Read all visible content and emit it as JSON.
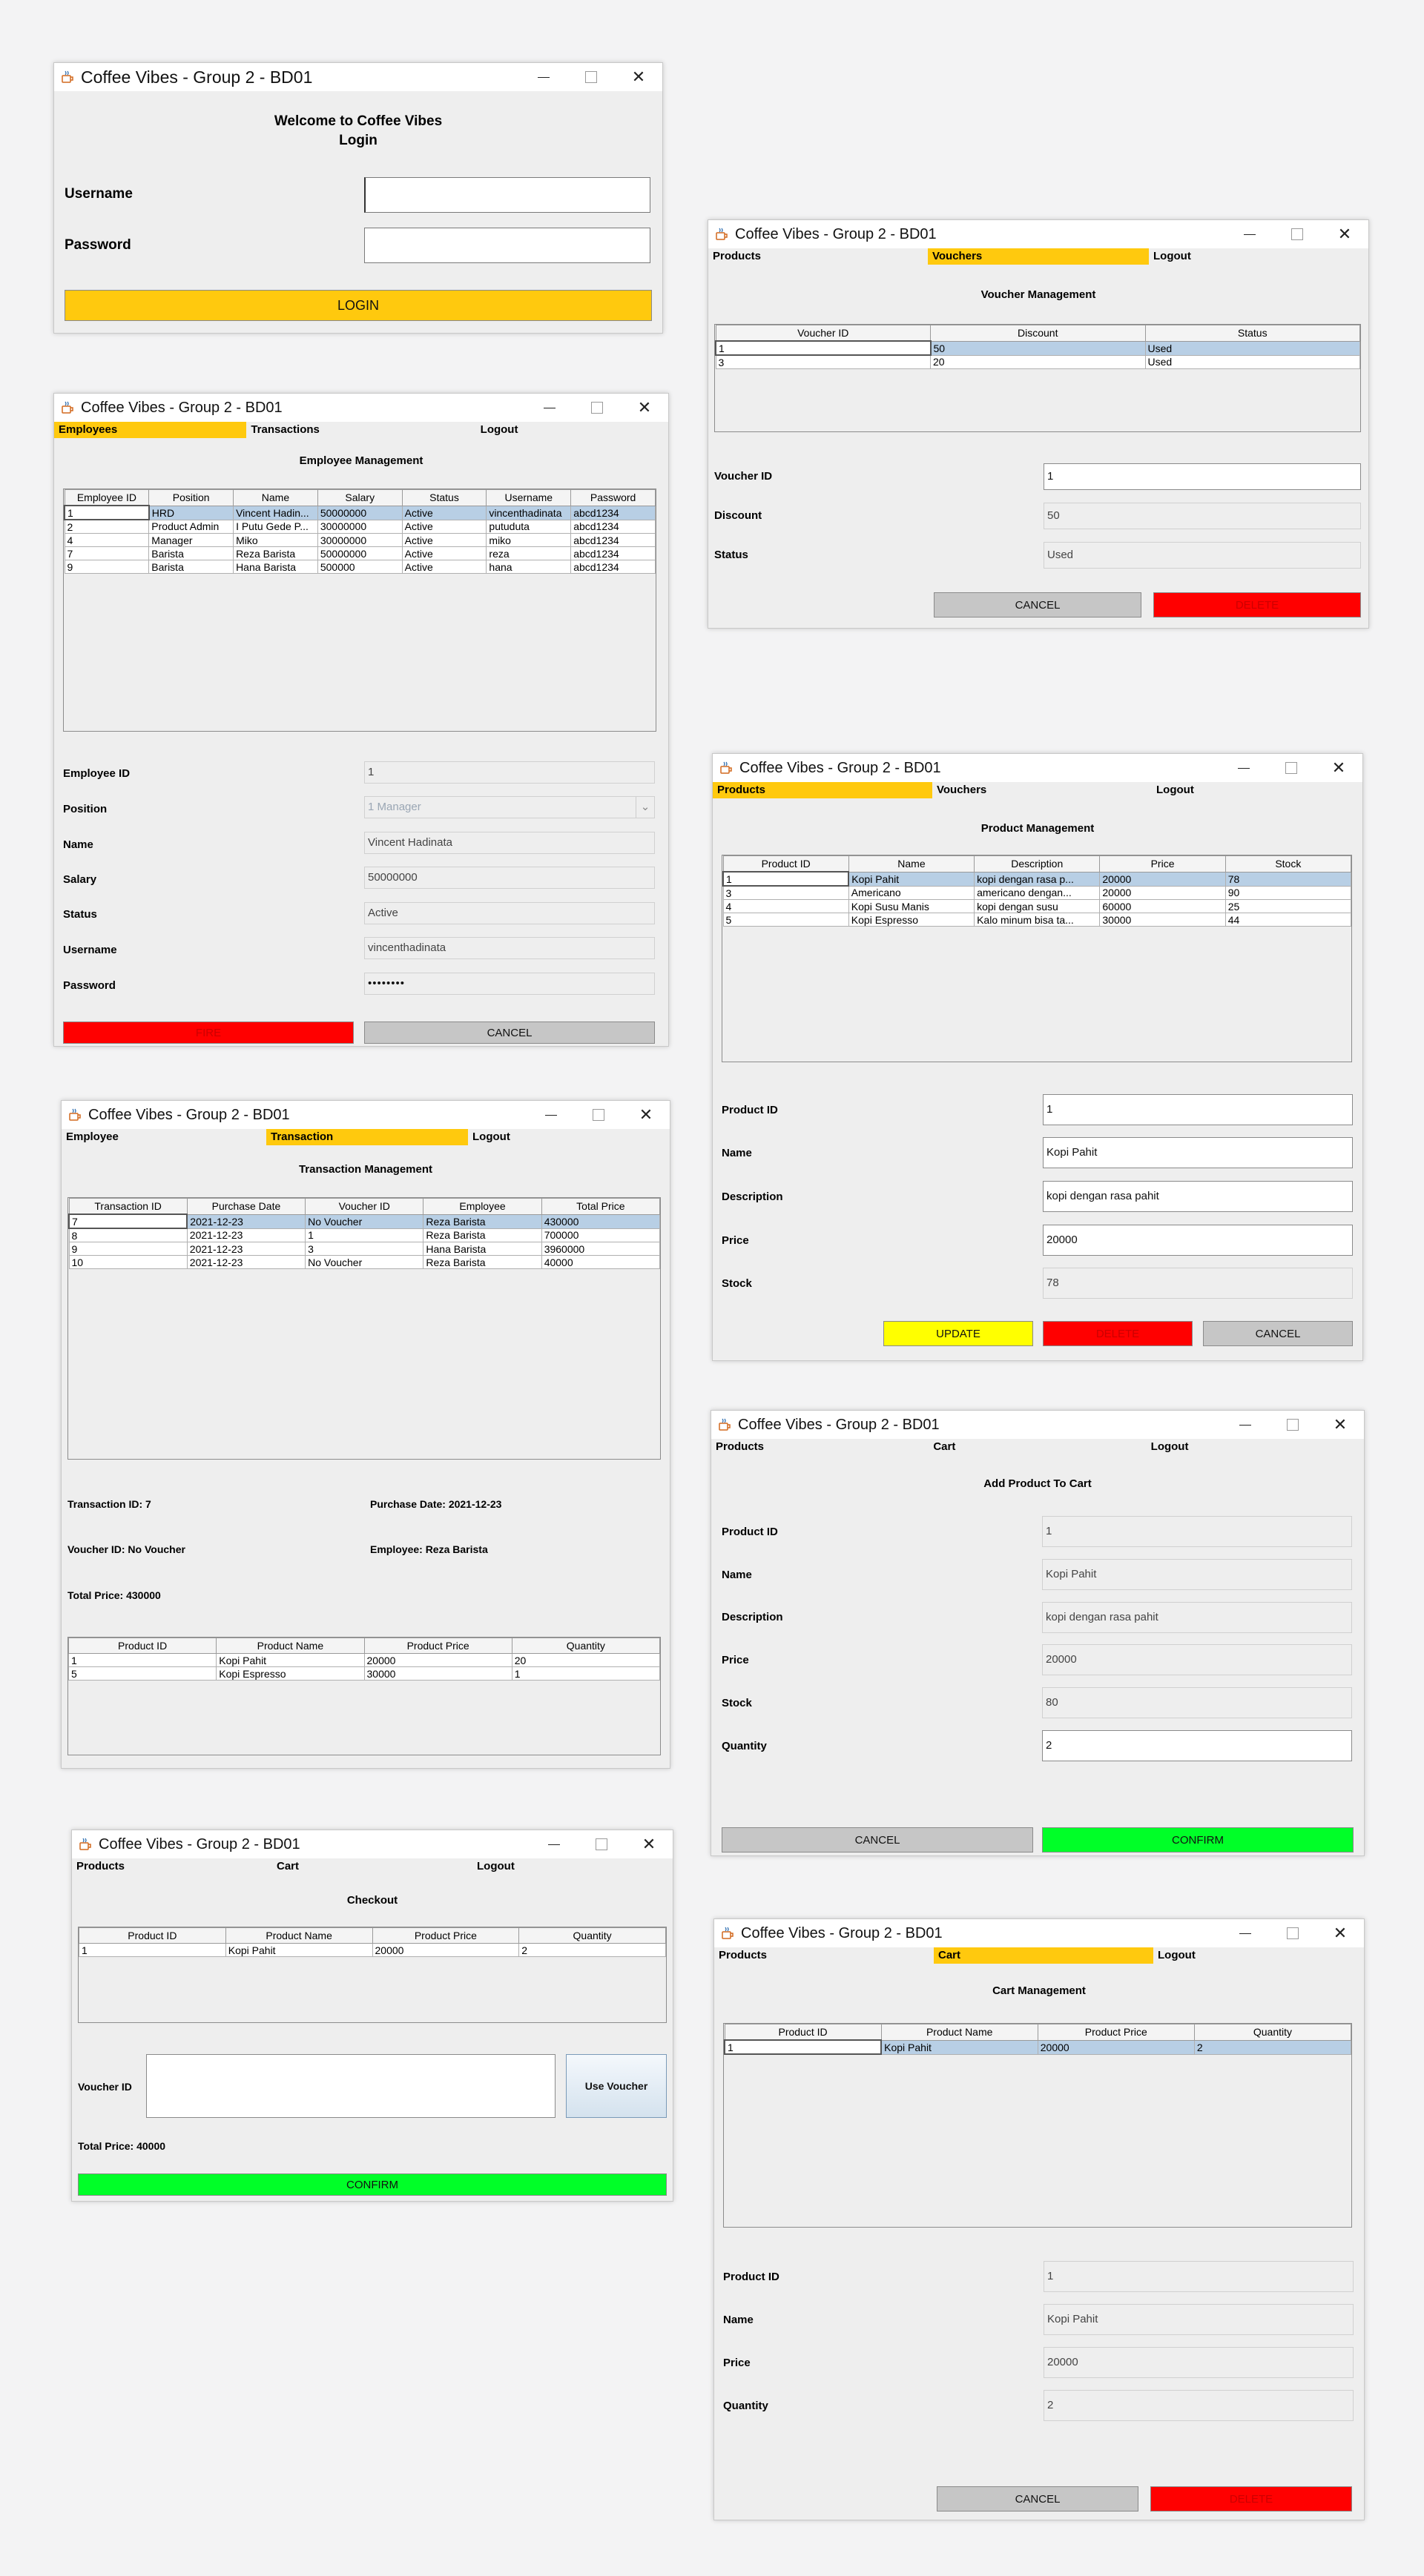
{
  "app_title": "Coffee Vibes - Group 2 - BD01",
  "title_controls": {
    "minimize": "—",
    "close": "✕"
  },
  "login": {
    "welcome": "Welcome to Coffee Vibes",
    "subtitle": "Login",
    "username_label": "Username",
    "password_label": "Password",
    "username_value": "",
    "password_value": "",
    "login_button": "LOGIN"
  },
  "employee": {
    "menu": [
      "Employees",
      "Transactions",
      "Logout"
    ],
    "active_menu": 0,
    "heading": "Employee Management",
    "columns": [
      "Employee ID",
      "Position",
      "Name",
      "Salary",
      "Status",
      "Username",
      "Password"
    ],
    "rows": [
      [
        "1",
        "HRD",
        "Vincent Hadin...",
        "50000000",
        "Active",
        "vincenthadinata",
        "abcd1234"
      ],
      [
        "2",
        "Product Admin",
        "I Putu Gede P...",
        "30000000",
        "Active",
        "putuduta",
        "abcd1234"
      ],
      [
        "4",
        "Manager",
        "Miko",
        "30000000",
        "Active",
        "miko",
        "abcd1234"
      ],
      [
        "7",
        "Barista",
        "Reza Barista",
        "50000000",
        "Active",
        "reza",
        "abcd1234"
      ],
      [
        "9",
        "Barista",
        "Hana Barista",
        "500000",
        "Active",
        "hana",
        "abcd1234"
      ]
    ],
    "selected_row": 0,
    "form": {
      "id_label": "Employee ID",
      "id_value": "1",
      "position_label": "Position",
      "position_value": "1 Manager",
      "name_label": "Name",
      "name_value": "Vincent Hadinata",
      "salary_label": "Salary",
      "salary_value": "50000000",
      "status_label": "Status",
      "status_value": "Active",
      "username_label": "Username",
      "username_value": "vincenthadinata",
      "password_label": "Password",
      "password_value": "••••••••"
    },
    "fire_button": "FIRE",
    "cancel_button": "CANCEL"
  },
  "transaction": {
    "menu": [
      "Employee",
      "Transaction",
      "Logout"
    ],
    "active_menu": 1,
    "heading": "Transaction Management",
    "columns": [
      "Transaction ID",
      "Purchase Date",
      "Voucher ID",
      "Employee",
      "Total Price"
    ],
    "rows": [
      [
        "7",
        "2021-12-23",
        "No Voucher",
        "Reza Barista",
        "430000"
      ],
      [
        "8",
        "2021-12-23",
        "1",
        "Reza Barista",
        "700000"
      ],
      [
        "9",
        "2021-12-23",
        "3",
        "Hana Barista",
        "3960000"
      ],
      [
        "10",
        "2021-12-23",
        "No Voucher",
        "Reza Barista",
        "40000"
      ]
    ],
    "selected_row": 0,
    "info": {
      "transaction_id": "Transaction ID: 7",
      "purchase_date": "Purchase Date: 2021-12-23",
      "voucher_id": "Voucher ID: No Voucher",
      "employee": "Employee: Reza Barista",
      "total_price": "Total Price: 430000"
    },
    "detail_columns": [
      "Product ID",
      "Product Name",
      "Product Price",
      "Quantity"
    ],
    "detail_rows": [
      [
        "1",
        "Kopi Pahit",
        "20000",
        "20"
      ],
      [
        "5",
        "Kopi Espresso",
        "30000",
        "1"
      ]
    ]
  },
  "checkout": {
    "menu": [
      "Products",
      "Cart",
      "Logout"
    ],
    "heading": "Checkout",
    "columns": [
      "Product ID",
      "Product Name",
      "Product Price",
      "Quantity"
    ],
    "rows": [
      [
        "1",
        "Kopi Pahit",
        "20000",
        "2"
      ]
    ],
    "voucher_label": "Voucher ID",
    "voucher_value": "",
    "use_voucher_button": "Use Voucher",
    "total_price": "Total Price: 40000",
    "confirm_button": "CONFIRM"
  },
  "voucher": {
    "menu": [
      "Products",
      "Vouchers",
      "Logout"
    ],
    "active_menu": 1,
    "heading": "Voucher Management",
    "columns": [
      "Voucher ID",
      "Discount",
      "Status"
    ],
    "rows": [
      [
        "1",
        "50",
        "Used"
      ],
      [
        "3",
        "20",
        "Used"
      ]
    ],
    "selected_row": 0,
    "form": {
      "id_label": "Voucher ID",
      "id_value": "1",
      "discount_label": "Discount",
      "discount_value": "50",
      "status_label": "Status",
      "status_value": "Used"
    },
    "cancel_button": "CANCEL",
    "delete_button": "DELETE"
  },
  "product": {
    "menu": [
      "Products",
      "Vouchers",
      "Logout"
    ],
    "active_menu": 0,
    "heading": "Product Management",
    "columns": [
      "Product ID",
      "Name",
      "Description",
      "Price",
      "Stock"
    ],
    "rows": [
      [
        "1",
        "Kopi Pahit",
        "kopi dengan rasa p...",
        "20000",
        "78"
      ],
      [
        "3",
        "Americano",
        "americano dengan...",
        "20000",
        "90"
      ],
      [
        "4",
        "Kopi Susu Manis",
        "kopi dengan susu",
        "60000",
        "25"
      ],
      [
        "5",
        "Kopi Espresso",
        "Kalo minum bisa ta...",
        "30000",
        "44"
      ]
    ],
    "selected_row": 0,
    "form": {
      "id_label": "Product ID",
      "id_value": "1",
      "name_label": "Name",
      "name_value": "Kopi Pahit",
      "description_label": "Description",
      "description_value": "kopi dengan rasa pahit",
      "price_label": "Price",
      "price_value": "20000",
      "stock_label": "Stock",
      "stock_value": "78"
    },
    "update_button": "UPDATE",
    "delete_button": "DELETE",
    "cancel_button": "CANCEL"
  },
  "add_to_cart": {
    "menu": [
      "Products",
      "Cart",
      "Logout"
    ],
    "heading": "Add Product To Cart",
    "form": {
      "id_label": "Product ID",
      "id_value": "1",
      "name_label": "Name",
      "name_value": "Kopi Pahit",
      "description_label": "Description",
      "description_value": "kopi dengan rasa pahit",
      "price_label": "Price",
      "price_value": "20000",
      "stock_label": "Stock",
      "stock_value": "80",
      "quantity_label": "Quantity",
      "quantity_value": "2"
    },
    "cancel_button": "CANCEL",
    "confirm_button": "CONFIRM"
  },
  "cart": {
    "menu": [
      "Products",
      "Cart",
      "Logout"
    ],
    "active_menu": 1,
    "heading": "Cart Management",
    "columns": [
      "Product ID",
      "Product Name",
      "Product Price",
      "Quantity"
    ],
    "rows": [
      [
        "1",
        "Kopi Pahit",
        "20000",
        "2"
      ]
    ],
    "selected_row": 0,
    "form": {
      "id_label": "Product ID",
      "id_value": "1",
      "name_label": "Name",
      "name_value": "Kopi Pahit",
      "price_label": "Price",
      "price_value": "20000",
      "quantity_label": "Quantity",
      "quantity_value": "2"
    },
    "cancel_button": "CANCEL",
    "delete_button": "DELETE"
  }
}
